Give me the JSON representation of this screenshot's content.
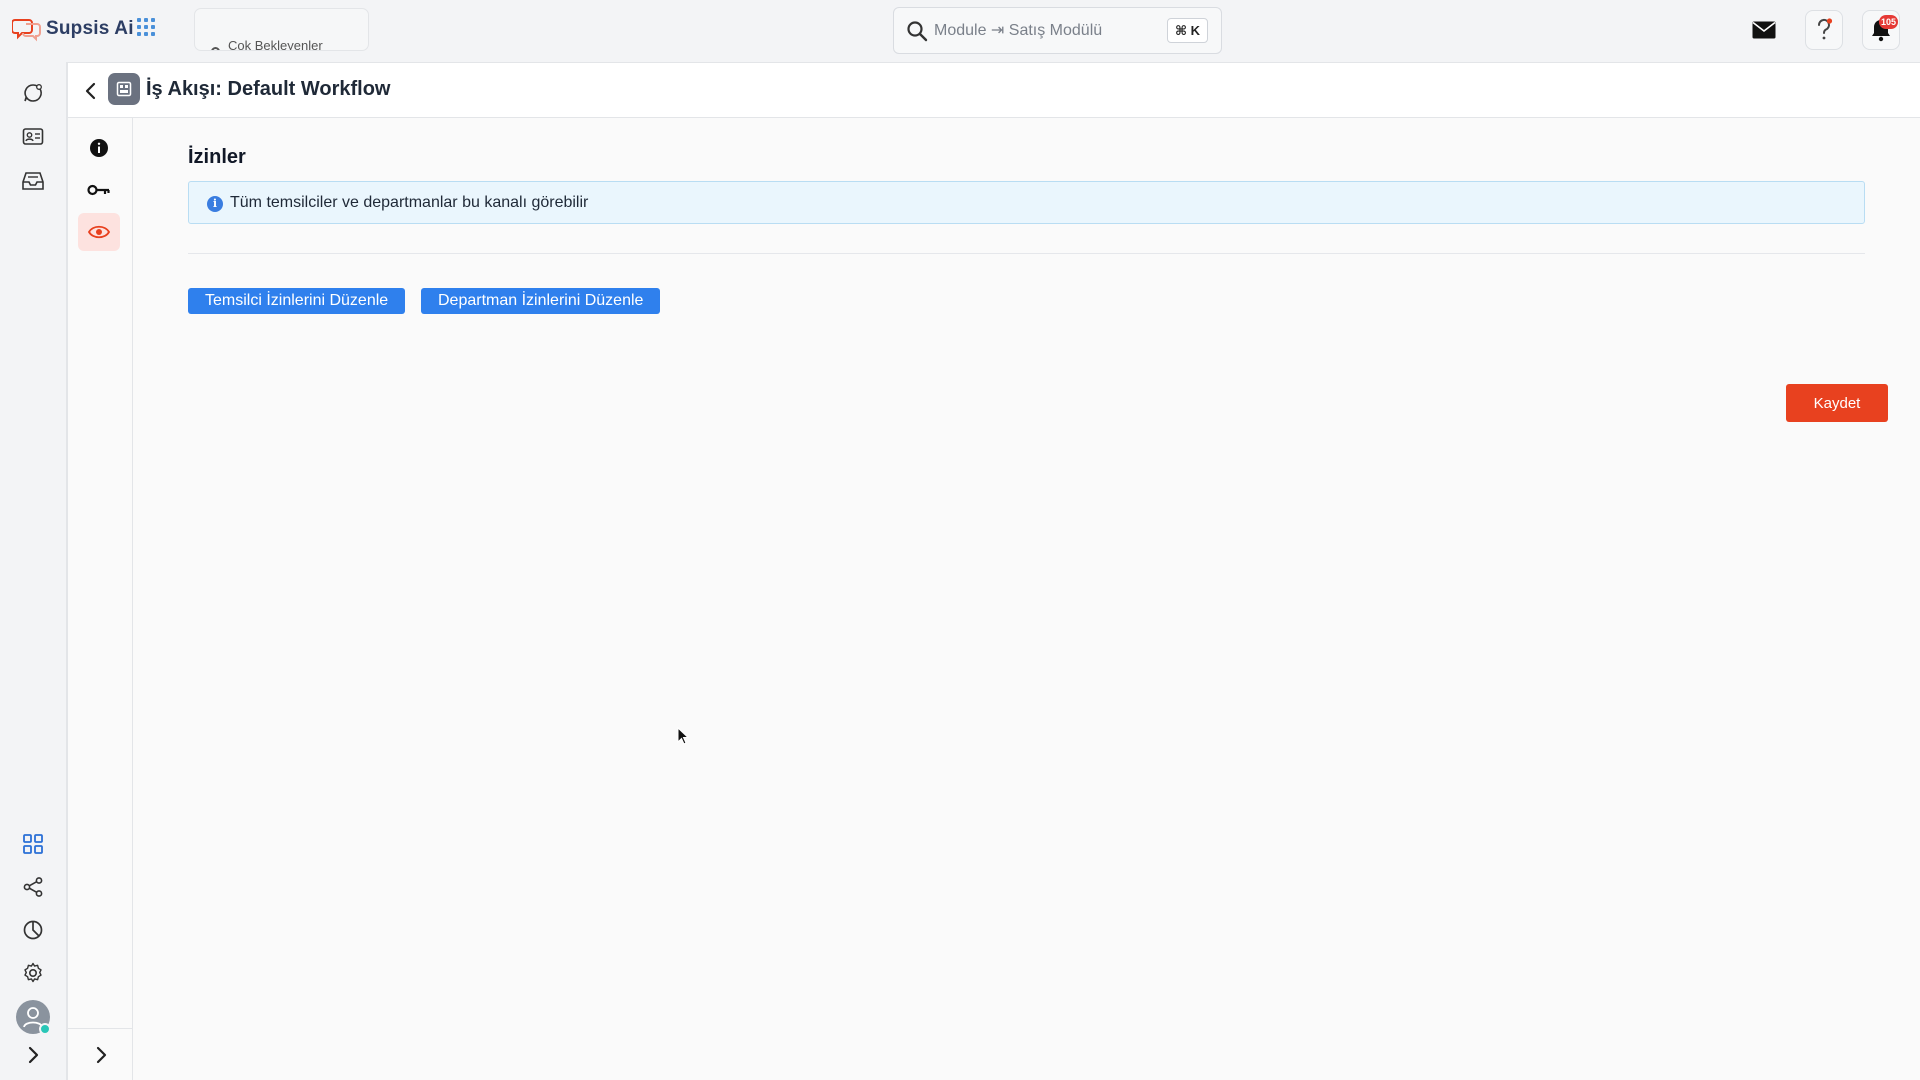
{
  "brand": {
    "name": "Supsis Ai",
    "logo_icon": "chat-bubbles-logo",
    "accent": "#e8411f",
    "brand_text_color": "#2d3e64"
  },
  "topbar": {
    "apps_icon": "grid-icon",
    "recent_tab_label": "Çok Bekleyenler",
    "search": {
      "placeholder": "Module ⇥ Satış Modülü",
      "shortcut": "⌘ K"
    },
    "mail_icon": "mail-icon",
    "help_icon": "question-icon",
    "notifications": {
      "icon": "bell-icon",
      "badge": "105"
    }
  },
  "rail": {
    "items": [
      "chat-icon",
      "contacts-icon",
      "inbox-icon"
    ],
    "bottom_items": [
      "dashboard-icon",
      "share-icon",
      "reports-icon",
      "settings-icon"
    ],
    "avatar": "user-avatar"
  },
  "page": {
    "title": "İş Akışı: Default Workflow",
    "sub_nav": [
      "info-icon",
      "key-icon",
      "eye-icon"
    ],
    "active_sub_nav": "eye-icon"
  },
  "permissions": {
    "title": "İzinler",
    "info_text": "Tüm temsilciler ve departmanlar bu kanalı görebilir",
    "edit_agents_label": "Temsilci İzinlerini Düzenle",
    "edit_departments_label": "Departman İzinlerini Düzenle",
    "save_label": "Kaydet"
  },
  "colors": {
    "primary_button": "#2f80ed",
    "save_button": "#e8411f",
    "info_bg": "#eaf6fd"
  }
}
